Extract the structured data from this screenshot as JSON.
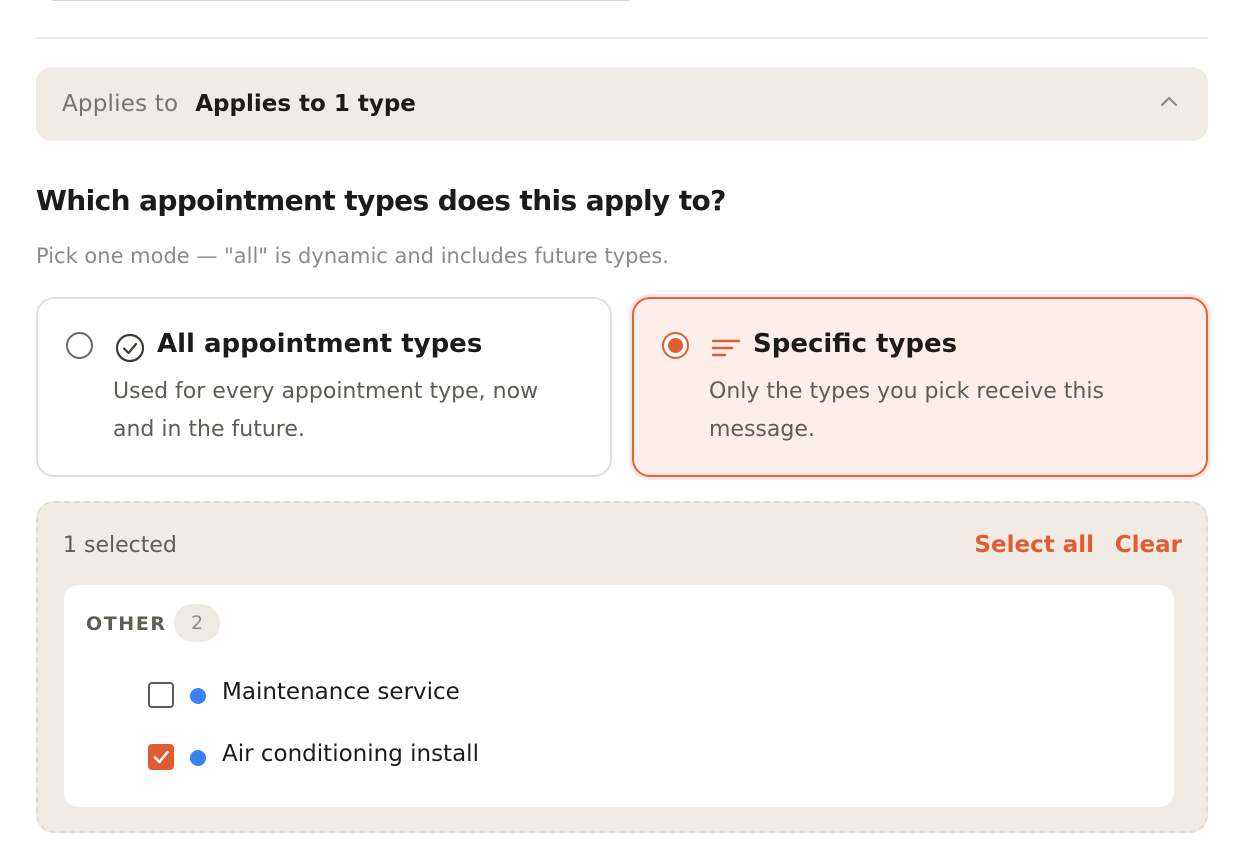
{
  "applies": {
    "label": "Applies to",
    "value": "Applies to 1 type"
  },
  "question": "Which appointment types does this apply to?",
  "hint": "Pick one mode — \"all\" is dynamic and includes future types.",
  "modes": [
    {
      "title": "All appointment types",
      "description": "Used for every appointment type, now and in the future.",
      "icon": "check-circle-icon",
      "selected": false
    },
    {
      "title": "Specific types",
      "description": "Only the types you pick receive this message.",
      "icon": "filter-lines-icon",
      "selected": true
    }
  ],
  "picker": {
    "selected_count": "1 selected",
    "select_all_label": "Select all",
    "clear_label": "Clear",
    "group": {
      "title": "OTHER",
      "count": "2",
      "items": [
        {
          "label": "Maintenance service",
          "checked": false,
          "dot_color": "#3b82f6"
        },
        {
          "label": "Air conditioning install",
          "checked": true,
          "dot_color": "#3b82f6"
        }
      ]
    }
  },
  "colors": {
    "accent": "#e25c31",
    "panel": "#f0ebe4",
    "selected_card_bg": "#fdeeea"
  }
}
